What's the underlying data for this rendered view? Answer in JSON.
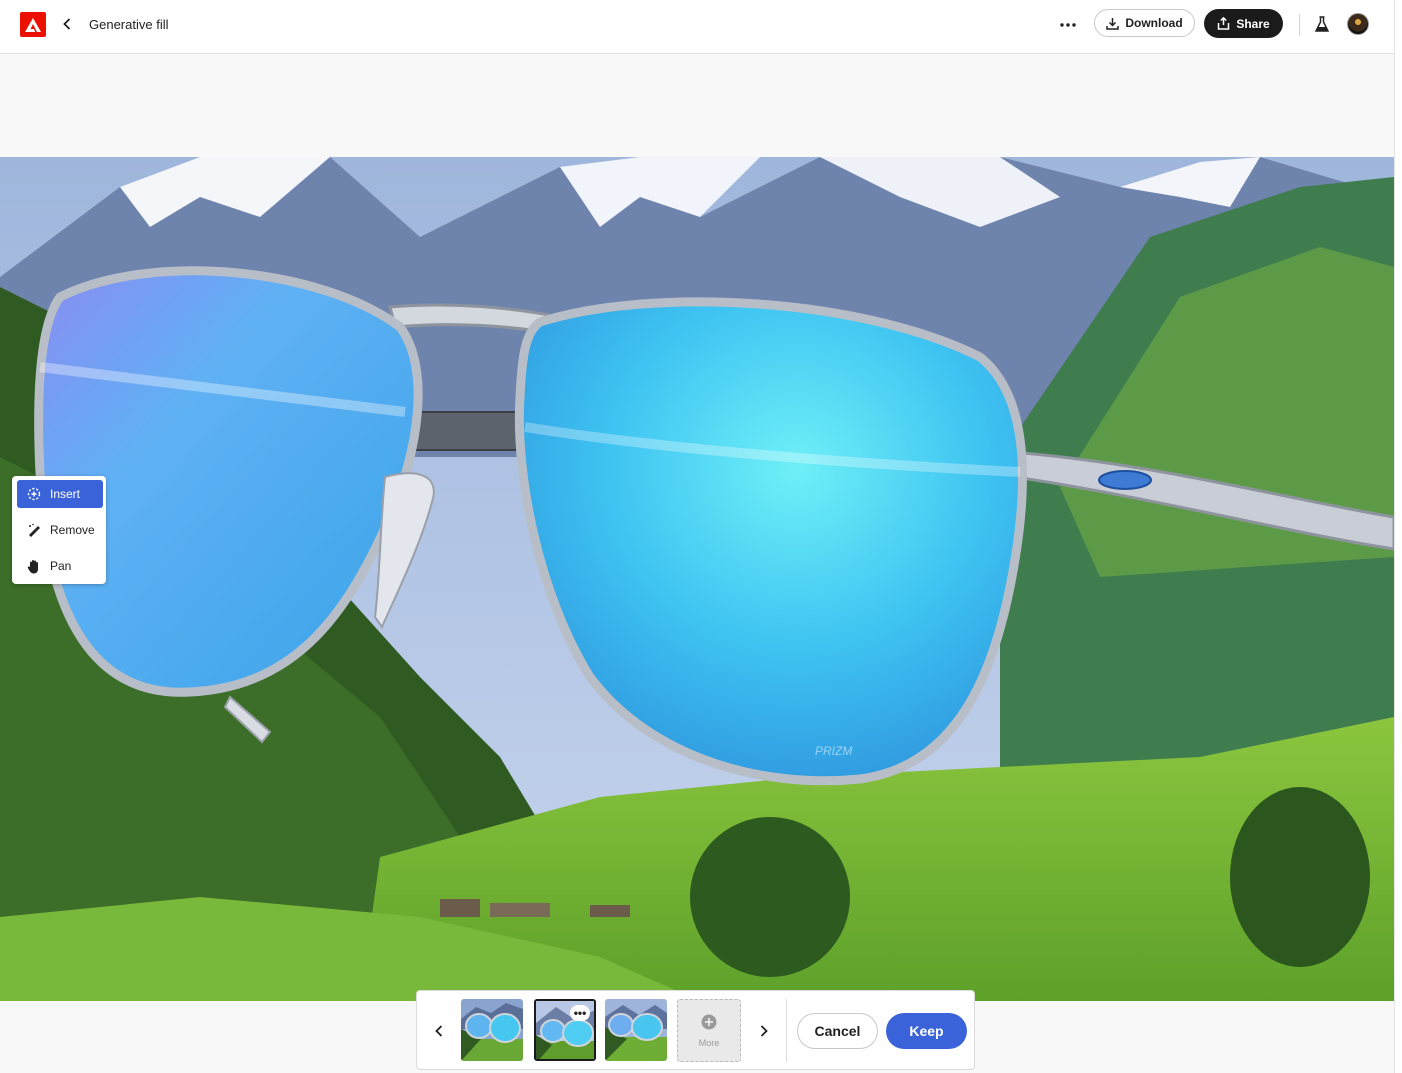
{
  "header": {
    "title": "Generative fill",
    "download_label": "Download",
    "share_label": "Share"
  },
  "tools": {
    "items": [
      {
        "label": "Insert",
        "icon": "insert-icon",
        "active": true
      },
      {
        "label": "Remove",
        "icon": "remove-icon",
        "active": false
      },
      {
        "label": "Pan",
        "icon": "hand-icon",
        "active": false
      }
    ]
  },
  "variations": {
    "count": 3,
    "selected_index": 1,
    "more_label": "More"
  },
  "actions": {
    "cancel_label": "Cancel",
    "keep_label": "Keep"
  },
  "lens_mark": "PRIZM",
  "colors": {
    "accent": "#3b63d9",
    "brand": "#eb1000",
    "share_bg": "#1b1b1b"
  }
}
